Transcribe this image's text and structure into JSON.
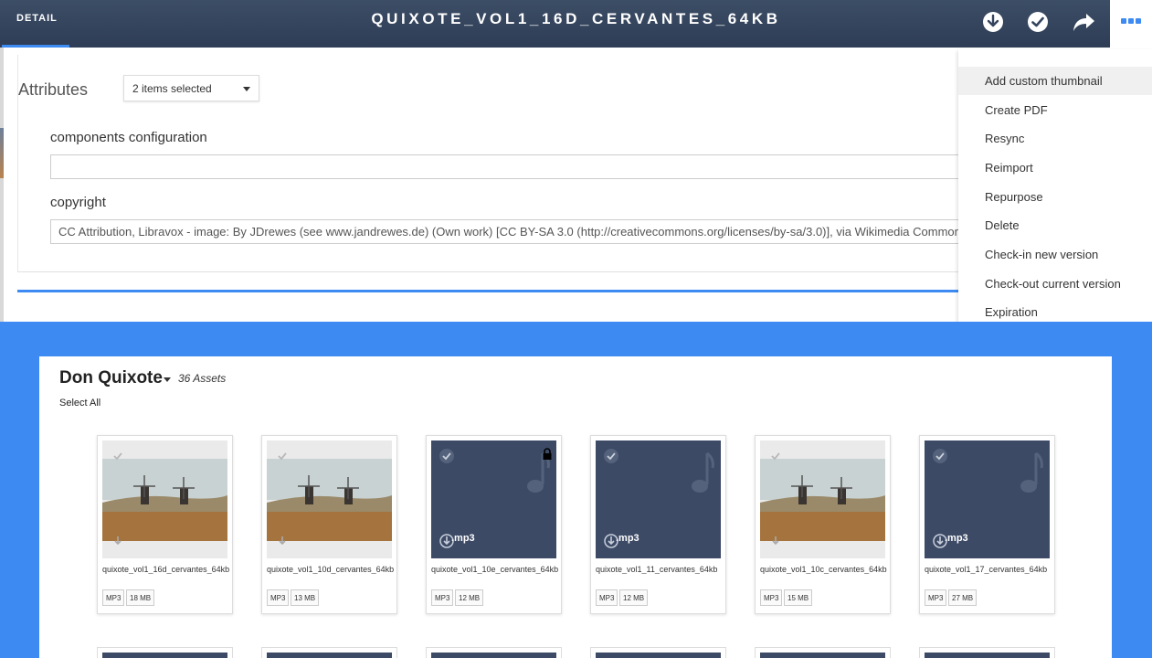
{
  "header": {
    "tab_label": "DETAIL",
    "title": "QUIXOTE_VOL1_16D_CERVANTES_64KB",
    "icons": [
      "download-icon",
      "check-icon",
      "share-icon",
      "more-icon"
    ]
  },
  "detail": {
    "attributes_label": "Attributes",
    "select_value": "2 items selected",
    "fields": [
      {
        "label": "components configuration",
        "value": ""
      },
      {
        "label": "copyright",
        "value": "CC Attribution, Libravox - image: By JDrewes (see www.jandrewes.de) (Own work) [CC BY-SA 3.0 (http://creativecommons.org/licenses/by-sa/3.0)], via Wikimedia Commons"
      }
    ]
  },
  "menu": {
    "items": [
      "Add custom thumbnail",
      "Create PDF",
      "Resync",
      "Reimport",
      "Repurpose",
      "Delete",
      "Check-in new version",
      "Check-out current version",
      "Expiration"
    ]
  },
  "collection": {
    "title": "Don Quixote",
    "count": "36 Assets",
    "select_all": "Select All",
    "assets": [
      {
        "name": "quixote_vol1_16d_cervantes_64kb",
        "type": "MP3",
        "size": "18 MB",
        "thumb": "photo",
        "ext": ""
      },
      {
        "name": "quixote_vol1_10d_cervantes_64kb",
        "type": "MP3",
        "size": "13 MB",
        "thumb": "photo",
        "ext": ""
      },
      {
        "name": "quixote_vol1_10e_cervantes_64kb",
        "type": "MP3",
        "size": "12 MB",
        "thumb": "audio",
        "ext": ".mp3",
        "locked": true
      },
      {
        "name": "quixote_vol1_11_cervantes_64kb",
        "type": "MP3",
        "size": "12 MB",
        "thumb": "audio",
        "ext": ".mp3"
      },
      {
        "name": "quixote_vol1_10c_cervantes_64kb",
        "type": "MP3",
        "size": "15 MB",
        "thumb": "photo",
        "ext": ""
      },
      {
        "name": "quixote_vol1_17_cervantes_64kb",
        "type": "MP3",
        "size": "27 MB",
        "thumb": "audio",
        "ext": ".mp3"
      }
    ]
  },
  "colors": {
    "header_bg": "#34445e",
    "accent": "#3d8bf2",
    "audio_thumb": "#3c4a66"
  }
}
